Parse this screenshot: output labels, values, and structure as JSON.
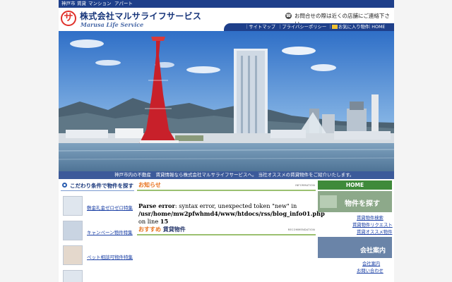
{
  "topnav": {
    "items": [
      "神戸市",
      "賃貸",
      "マンション",
      "アパート"
    ]
  },
  "header": {
    "logo_char": "サ",
    "company_name": "株式会社マルサライフサービス",
    "company_sub": "Marusa Life Service",
    "contact": "お問合せの際は近くの店舗にご連絡下さい"
  },
  "nav": {
    "items": [
      "｜サイトマップ",
      "｜プライバシーポリシー",
      "｜",
      "お気に入り物件",
      "｜HOME"
    ]
  },
  "caption": "神戸市内の不動産　賃貸情報なら株式会社マルサライフサービスへ。 当社オススメの賃貸物件をご紹介いたします。",
  "sidebar": {
    "title": "こだわり条件で物件を探す",
    "items": [
      "敷金礼金ゼロゼロ特集",
      "キャンペーン物件特集",
      "ペット相談可物件特集"
    ]
  },
  "news": {
    "title": "お知らせ",
    "eng": "INFORMATION"
  },
  "error": {
    "label": "Parse error",
    "message": ": syntax error, unexpected token \"new\" in",
    "path": "/usr/home/mw2pfwhmd4/www/htdocs/rss/blog_info01.php",
    "line_text": " on line ",
    "line": "15"
  },
  "recommend": {
    "title_orange": "おすすめ",
    "title_dark": "賃貸物件",
    "eng": "RECOMMENDATION"
  },
  "right": {
    "home": "HOME",
    "search_banner": "物件を探す",
    "search_links": [
      "賃貸物件検索",
      "賃貸物件リクエスト",
      "賃貸オススメ物件"
    ],
    "company_banner": "会社案内",
    "company_links": [
      "会社案内",
      "お問い合わせ"
    ]
  },
  "colors": {
    "brand": "#1e3f8a",
    "accent_green": "#3f8a3a",
    "accent_orange": "#e8701a",
    "logo_red": "#e0302a"
  }
}
